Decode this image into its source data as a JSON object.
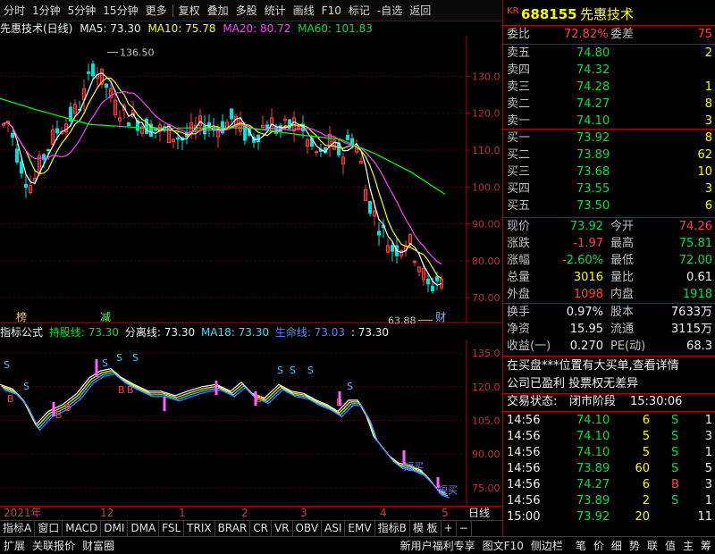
{
  "toolbar": {
    "items": [
      "分时",
      "1分钟",
      "5分钟",
      "15分钟",
      "更多",
      "复权",
      "叠加",
      "多股",
      "统计",
      "画线",
      "F10",
      "标记",
      "-自选",
      "返回"
    ]
  },
  "title": {
    "stock": "先惠技术(日线)",
    "ma5": "MA5: 73.30",
    "ma10": "MA10: 75.78",
    "ma20": "MA20: 80.72",
    "ma60": "MA60: 101.83"
  },
  "colors": {
    "ma5": "#ffffff",
    "ma10": "#ffff00",
    "ma20": "#ff40ff",
    "ma60": "#00ff00",
    "up": "#ff3c3c",
    "down": "#00e0e0",
    "axis": "#c03030"
  },
  "main_axis": {
    "ticks": [
      "130.0",
      "120.0",
      "110.0",
      "100.0",
      "90.00",
      "80.00",
      "70.00"
    ],
    "values": [
      130,
      120,
      110,
      100,
      90,
      80,
      70
    ],
    "min": 63,
    "max": 141,
    "high_label": "136.50",
    "low_label": "63.88",
    "marks": {
      "bang": "榜",
      "jian": "减",
      "cai": "财"
    }
  },
  "sub_header": {
    "prefix": "指标公式",
    "hold": "持股线: 73.30",
    "dev": "分离线: 73.30",
    "ma18": "MA18: 73.30",
    "life": "生命线: 73.03",
    "last": ": 73.30"
  },
  "sub_axis": {
    "ticks": [
      "135.0",
      "120.0",
      "105.0",
      "90.00",
      "75.00"
    ],
    "values": [
      135,
      120,
      105,
      90,
      75
    ],
    "min": 67,
    "max": 141,
    "labels": {
      "s": "S",
      "b": "B",
      "duanmai": "短买"
    }
  },
  "xaxis": {
    "labels": [
      "2021年",
      "12",
      "1",
      "2",
      "3",
      "4",
      "5"
    ],
    "period": "日线"
  },
  "tabs": [
    "指标A",
    "窗口",
    "MACD",
    "DMI",
    "DMA",
    "FSL",
    "TRIX",
    "BRAR",
    "CR",
    "VR",
    "OBV",
    "ASI",
    "EMV",
    "指标B",
    "模 板",
    "+",
    "−"
  ],
  "bottom": {
    "left": [
      "扩展",
      "关联报价",
      "财富圈"
    ],
    "right": [
      "新用户福利专享",
      "图文F10",
      "侧边栏"
    ],
    "side": [
      "笔",
      "价",
      "细",
      "势",
      "联",
      "值",
      "主",
      "筹"
    ]
  },
  "quote": {
    "badge": "KR",
    "code": "688155",
    "name": "先惠技术",
    "weibi_label": "委比",
    "weibi": "72.82%",
    "weicha_label": "委差",
    "weicha": "75",
    "sells": [
      {
        "label": "卖五",
        "price": "74.80",
        "vol": "2"
      },
      {
        "label": "卖四",
        "price": "74.32",
        "vol": ""
      },
      {
        "label": "卖三",
        "price": "74.28",
        "vol": "1"
      },
      {
        "label": "卖二",
        "price": "74.27",
        "vol": "8"
      },
      {
        "label": "卖一",
        "price": "74.10",
        "vol": "3"
      }
    ],
    "buys": [
      {
        "label": "买一",
        "price": "73.92",
        "vol": "8"
      },
      {
        "label": "买二",
        "price": "73.89",
        "vol": "62"
      },
      {
        "label": "买三",
        "price": "73.68",
        "vol": "10"
      },
      {
        "label": "买四",
        "price": "73.55",
        "vol": "3"
      },
      {
        "label": "买五",
        "price": "73.50",
        "vol": "6"
      }
    ],
    "stats": [
      {
        "l1": "现价",
        "v1": "73.92",
        "l2": "今开",
        "v2": "74.26"
      },
      {
        "l1": "涨跌",
        "v1": "-1.97",
        "l2": "最高",
        "v2": "75.81"
      },
      {
        "l1": "涨幅",
        "v1": "-2.60%",
        "l2": "最低",
        "v2": "72.00"
      },
      {
        "l1": "总量",
        "v1": "3016",
        "l2": "量比",
        "v2": "0.61"
      },
      {
        "l1": "外盘",
        "v1": "1098",
        "l2": "内盘",
        "v2": "1918"
      }
    ],
    "stats2": [
      {
        "l1": "换手",
        "v1": "0.97%",
        "l2": "股本",
        "v2": "7633万"
      },
      {
        "l1": "净资",
        "v1": "15.95",
        "l2": "流通",
        "v2": "3115万"
      },
      {
        "l1": "收益(一)",
        "v1": "0.270",
        "l2": "PE(动)",
        "v2": "68.3"
      }
    ],
    "notice1": "在买盘***位置有大买单,查看详情",
    "notice2": "公司已盈利 投票权无差异",
    "status_label": "交易状态:",
    "status": "闭市阶段",
    "status_time": "15:30:06",
    "ticks": [
      {
        "t": "14:56",
        "p": "74.10",
        "v": "6",
        "d": "S",
        "n": "1"
      },
      {
        "t": "14:56",
        "p": "74.10",
        "v": "5",
        "d": "S",
        "n": "3"
      },
      {
        "t": "14:56",
        "p": "74.10",
        "v": "5",
        "d": "S",
        "n": "1"
      },
      {
        "t": "14:56",
        "p": "73.89",
        "v": "60",
        "d": "S",
        "n": "5"
      },
      {
        "t": "14:56",
        "p": "74.27",
        "v": "6",
        "d": "B",
        "n": "3"
      },
      {
        "t": "14:56",
        "p": "73.89",
        "v": "2",
        "d": "S",
        "n": "1"
      },
      {
        "t": "15:00",
        "p": "73.92",
        "v": "20",
        "d": "",
        "n": "11"
      }
    ]
  }
}
